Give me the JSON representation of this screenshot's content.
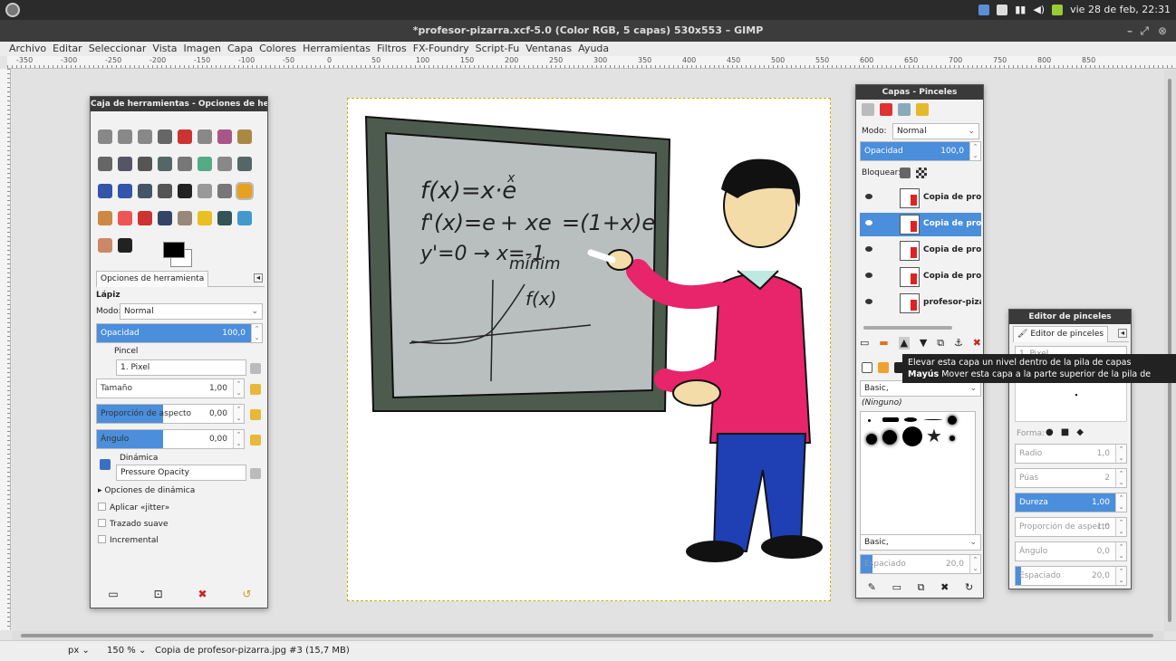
{
  "system": {
    "datetime": "vie 28 de feb, 22:31"
  },
  "window": {
    "title": "*profesor-pizarra.xcf-5.0 (Color RGB, 5 capas) 530x553 – GIMP"
  },
  "menu": [
    "Archivo",
    "Editar",
    "Seleccionar",
    "Vista",
    "Imagen",
    "Capa",
    "Colores",
    "Herramientas",
    "Filtros",
    "FX-Foundry",
    "Script-Fu",
    "Ventanas",
    "Ayuda"
  ],
  "ruler_labels": [
    "-350",
    "-300",
    "-250",
    "-200",
    "-150",
    "-100",
    "-50",
    "0",
    "50",
    "100",
    "150",
    "200",
    "250",
    "300",
    "350",
    "400",
    "450",
    "500",
    "550",
    "600",
    "650",
    "700",
    "750",
    "800",
    "850"
  ],
  "toolbox": {
    "title": "Caja de herramientas - Opciones de herram",
    "tab_label": "Opciones de herramienta",
    "tool_name": "Lápiz",
    "mode_label": "Modo:",
    "mode_value": "Normal",
    "opacity_label": "Opacidad",
    "opacity_value": "100,0",
    "brush_label": "Pincel",
    "brush_value": "1. Pixel",
    "size_label": "Tamaño",
    "size_value": "1,00",
    "aspect_label": "Proporción de aspecto",
    "aspect_value": "0,00",
    "angle_label": "Ángulo",
    "angle_value": "0,00",
    "dynamics_label": "Dinámica",
    "dynamics_value": "Pressure Opacity",
    "dynamics_options": "Opciones de dinámica",
    "jitter": "Aplicar «jitter»",
    "smooth": "Trazado suave",
    "incremental": "Incremental"
  },
  "layers": {
    "title": "Capas - Pinceles",
    "mode_label": "Modo:",
    "mode_value": "Normal",
    "opacity_label": "Opacidad",
    "opacity_value": "100,0",
    "lock_label": "Bloquear:",
    "items": [
      {
        "name": "Copia de profes"
      },
      {
        "name": "Copia de profes"
      },
      {
        "name": "Copia de profes"
      },
      {
        "name": "Copia de profes"
      },
      {
        "name": "profesor-pizarra"
      }
    ],
    "brush_tag": "Basic,",
    "brush_none": "(Ninguno)",
    "brush_tag2": "Basic,",
    "spacing_label": "Espaciado",
    "spacing_value": "20,0"
  },
  "brush_editor": {
    "title": "Editor de pinceles",
    "tab_label": "Editor de pinceles",
    "brush_name": "1. Pixel",
    "shape_label": "Forma:",
    "radius_label": "Radio",
    "radius_value": "1,0",
    "spikes_label": "Púas",
    "spikes_value": "2",
    "hardness_label": "Dureza",
    "hardness_value": "1,00",
    "aspect_label": "Proporción de aspecto",
    "aspect_value": "1,0",
    "angle_label": "Ángulo",
    "angle_value": "0,0",
    "spacing_label": "Espaciado",
    "spacing_value": "20,0"
  },
  "tooltip": {
    "line1": "Elevar esta capa un nivel dentro de la pila de capas",
    "line2_key": "Mayús",
    "line2_text": "Mover esta capa a la parte superior de la pila de capas"
  },
  "blackboard": {
    "line1": "f(x)=x·e",
    "line1_sup": "x",
    "line2": "f'(x)=e",
    "line2_mid": "+ xe",
    "line2_end": "=(1+x)e",
    "line3": "y'=0 → x=-1",
    "line4": "mínim",
    "curve_label": "f(x)"
  },
  "status": {
    "unit": "px",
    "zoom": "150 %",
    "message": "Copia de profesor-pizarra.jpg #3 (15,7 MB)"
  }
}
